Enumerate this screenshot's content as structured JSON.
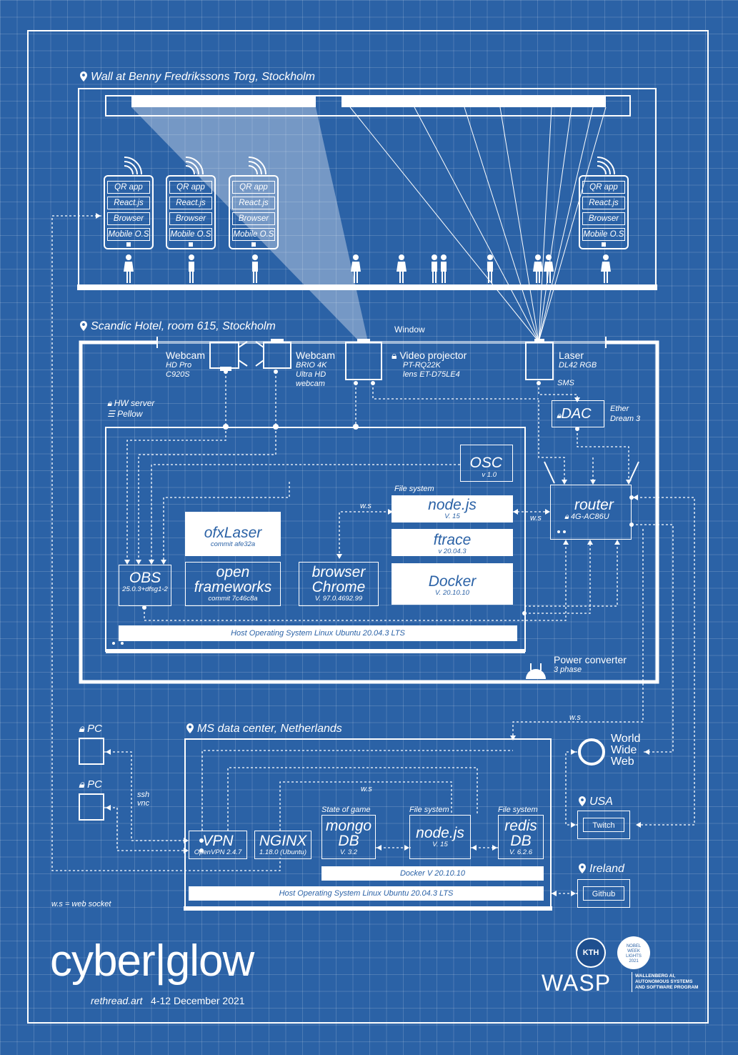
{
  "locations": {
    "wall": "Wall at Benny Fredrikssons Torg, Stockholm",
    "hotel": "Scandic Hotel, room 615, Stockholm",
    "datacenter": "MS data center, Netherlands",
    "usa": "USA",
    "ireland": "Ireland"
  },
  "phone_stack": [
    "QR app",
    "React.js",
    "Browser",
    "Mobile O.S"
  ],
  "hotel": {
    "window": "Window",
    "webcam1": {
      "title": "Webcam",
      "line1": "HD Pro",
      "line2": "C920S"
    },
    "webcam2": {
      "title": "Webcam",
      "line1": "BRIO 4K",
      "line2": "Ultra HD",
      "line3": "webcam"
    },
    "projector": {
      "title": "Video projector",
      "line1": "PT-RQ22K",
      "line2": "lens ET-D75LE4"
    },
    "laser": {
      "title": "Laser",
      "line1": "DL42 RGB"
    },
    "sms": "SMS",
    "dac": {
      "title": "DAC",
      "line1": "Ether",
      "line2": "Dream 3"
    },
    "hw_server": {
      "line1": "HW server",
      "line2": "Pellow"
    },
    "osc": {
      "title": "OSC",
      "version": "v 1.0"
    },
    "file_system": "File system",
    "node": {
      "title": "node.js",
      "version": "V. 15"
    },
    "ftrace": {
      "title": "ftrace",
      "version": "v 20.04.3"
    },
    "docker": {
      "title": "Docker",
      "version": "V. 20.10.10"
    },
    "ofxlaser": {
      "title": "ofxLaser",
      "version": "commit afe32a"
    },
    "openframeworks": {
      "line1": "open",
      "line2": "frameworks",
      "version": "commit 7c46c8a"
    },
    "chrome": {
      "line1": "browser",
      "line2": "Chrome",
      "version": "V. 97.0.4692.99"
    },
    "obs": {
      "title": "OBS",
      "version": "25.0.3+dfsg1-2"
    },
    "router": {
      "title": "router",
      "model": "4G-AC86U"
    },
    "ws1": "w.s",
    "ws2": "w.s",
    "host_os": "Host Operating System Linux Ubuntu 20.04.3 LTS",
    "power": {
      "line1": "Power converter",
      "line2": "3 phase"
    }
  },
  "pc1": "PC",
  "pc2": "PC",
  "ssh": {
    "line1": "ssh",
    "line2": "vnc"
  },
  "ws3": "w.s",
  "ws4": "w.s",
  "www": {
    "line1": "World",
    "line2": "Wide",
    "line3": "Web"
  },
  "datacenter": {
    "vpn": {
      "title": "VPN",
      "version": "OpenVPN 2.4.7"
    },
    "nginx": {
      "title": "NGINX",
      "version": "1.18.0 (Ubuntu)"
    },
    "state": "State of game",
    "mongo": {
      "line1": "mongo",
      "line2": "DB",
      "version": "V. 3.2"
    },
    "fs1": "File system",
    "node": {
      "title": "node.js",
      "version": "V. 15"
    },
    "fs2": "File system",
    "redis": {
      "line1": "redis",
      "line2": "DB",
      "version": "V. 6.2.6"
    },
    "docker": "Docker V 20.10.10",
    "host_os": "Host Operating System Linux Ubuntu 20.04.3 LTS"
  },
  "twitch": "Twitch",
  "github": "Github",
  "ws_legend": "w.s = web socket",
  "title": "cyber|glow",
  "subtitle": "rethread.art",
  "dates": "4-12 December 2021",
  "logos": {
    "kth": "KTH",
    "nobel": {
      "line1": "NOBEL",
      "line2": "WEEK",
      "line3": "LIGHTS",
      "line4": "2021"
    },
    "wasp": "WASP",
    "wasp_sub": {
      "line1": "WALLENBERG AI,",
      "line2": "AUTONOMOUS SYSTEMS",
      "line3": "AND SOFTWARE PROGRAM"
    }
  }
}
